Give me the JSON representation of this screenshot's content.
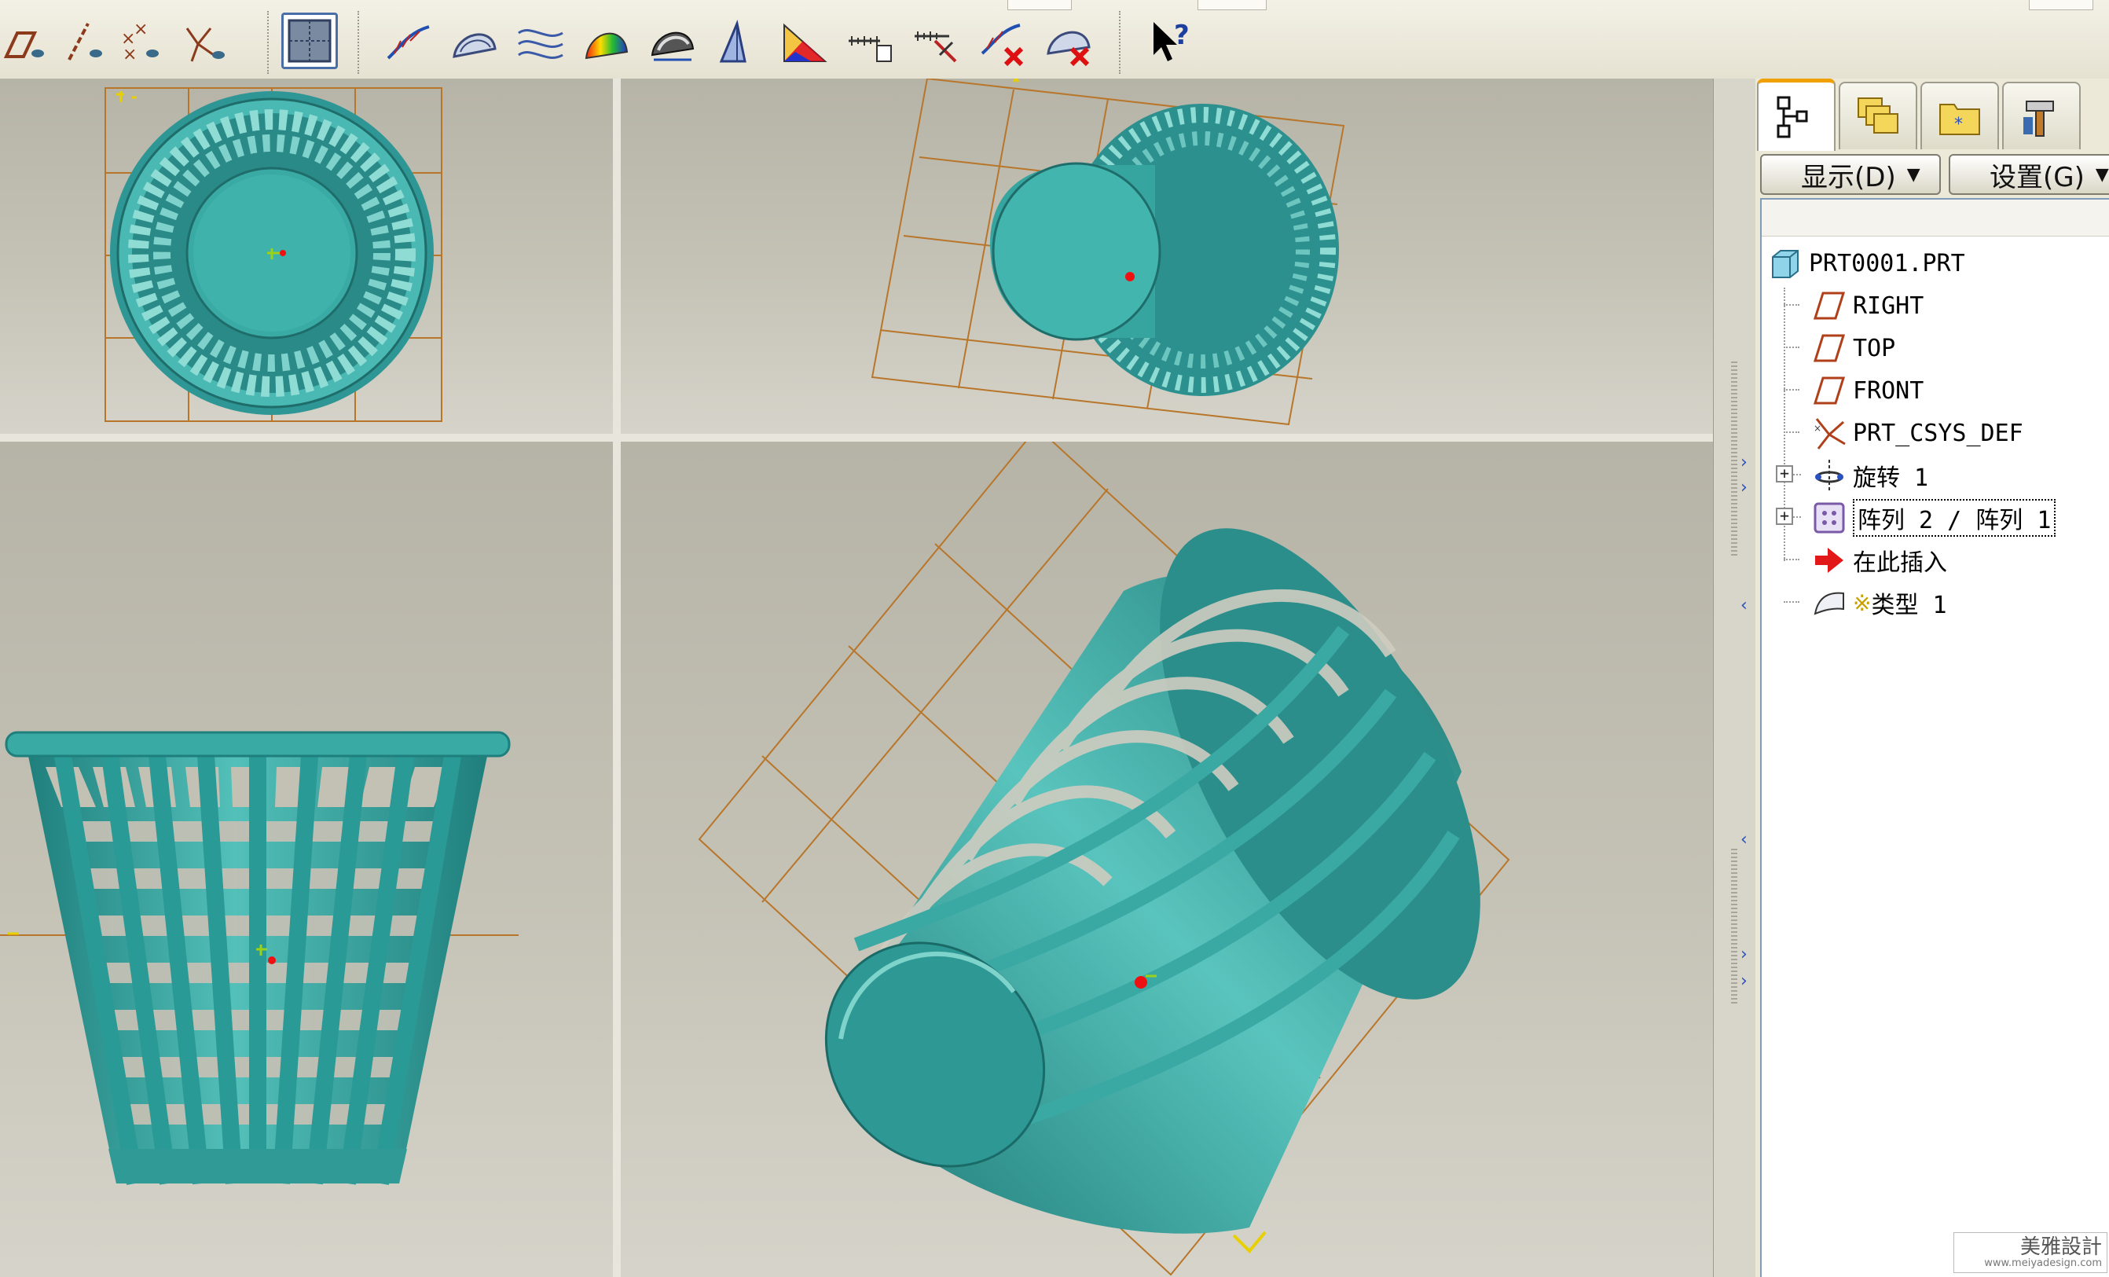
{
  "panel": {
    "display_button": "显示(D)",
    "settings_button": "设置(G)",
    "tabs": [
      "model-tree",
      "layers",
      "folder-browser",
      "tools"
    ]
  },
  "tree": {
    "root": "PRT0001.PRT",
    "items": [
      {
        "label": "RIGHT",
        "icon": "datum-plane-icon"
      },
      {
        "label": "TOP",
        "icon": "datum-plane-icon"
      },
      {
        "label": "FRONT",
        "icon": "datum-plane-icon"
      },
      {
        "label": "PRT_CSYS_DEF",
        "icon": "coordinate-system-icon"
      },
      {
        "label": "旋转 1",
        "icon": "revolve-icon",
        "expandable": true
      },
      {
        "label": "阵列 2 / 阵列 1",
        "icon": "pattern-icon",
        "expandable": true,
        "selected": true
      },
      {
        "label": "在此插入",
        "icon": "insert-here-arrow-icon"
      },
      {
        "label": "类型 1",
        "icon": "surface-feature-icon",
        "prefix": "※"
      }
    ]
  },
  "toolbar": {
    "icons": [
      "datum-plane-display-icon",
      "datum-axis-display-icon",
      "datum-point-display-icon",
      "coordinate-system-display-icon",
      "grid-toggle-icon",
      "curve-analysis-icon",
      "surface-analysis-icon",
      "curvature-icon",
      "shaded-curvature-icon",
      "draft-analysis-icon",
      "section-analysis-icon",
      "slope-analysis-icon",
      "measure-icon",
      "deviation-icon",
      "delete-curve-analysis-icon",
      "delete-surface-analysis-icon",
      "whats-this-help-icon"
    ]
  },
  "watermark": {
    "name": "美雅設計",
    "url": "www.meiyadesign.com"
  },
  "colors": {
    "model": "#2f9a98",
    "datum": "#b8762a",
    "accent": "#2a52be"
  }
}
